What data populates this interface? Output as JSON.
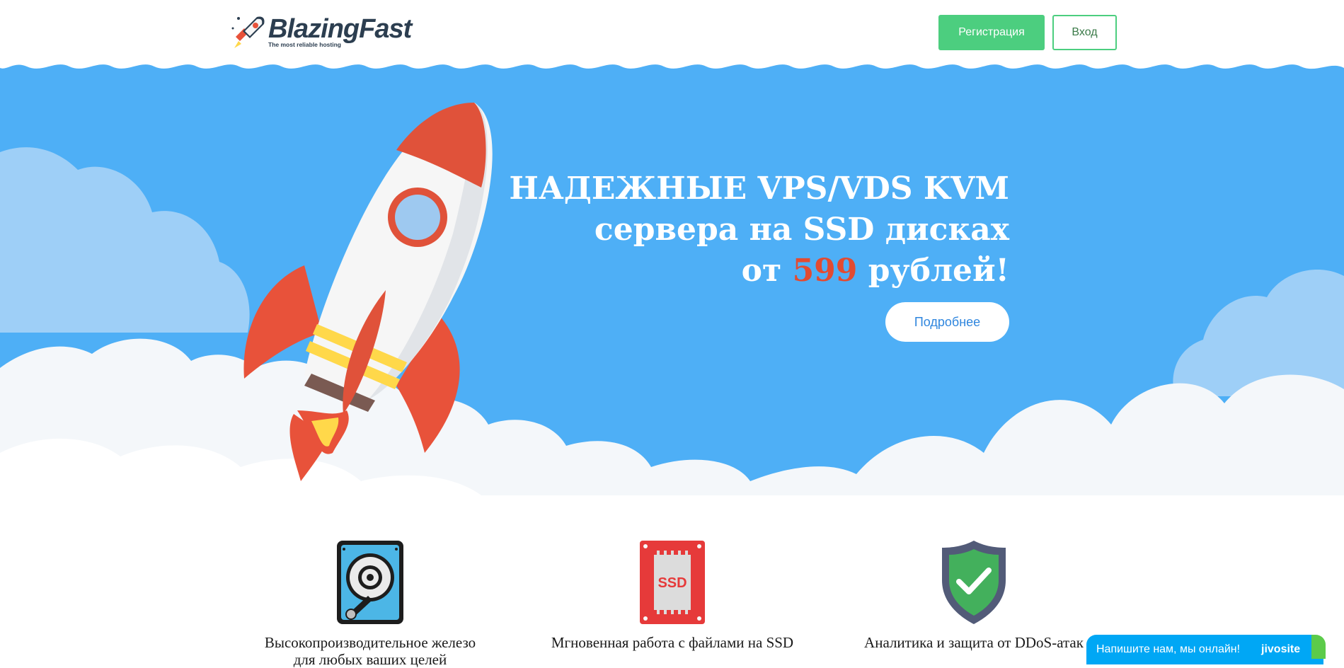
{
  "header": {
    "logo_name": "BlazingFast",
    "logo_tagline": "The most reliable hosting",
    "register_label": "Регистрация",
    "login_label": "Вход"
  },
  "hero": {
    "line1": "НАДЕЖНЫЕ VPS/VDS KVM",
    "line2": "сервера на SSD дисках",
    "line3_prefix": "от ",
    "price": "599",
    "line3_suffix": " рублей!",
    "more_label": "Подробнее"
  },
  "features": [
    {
      "icon": "hard-drive-icon",
      "label_line1": "Высокопроизводительное железо",
      "label_line2": "для любых ваших целей"
    },
    {
      "icon": "ssd-chip-icon",
      "ssd_text": "SSD",
      "label_line1": "Мгновенная работа с файлами на SSD"
    },
    {
      "icon": "shield-check-icon",
      "label_line1": "Аналитика и защита от DDoS-атак"
    }
  ],
  "chat": {
    "text": "Напишите нам, мы онлайн!",
    "brand": "jivosite"
  },
  "colors": {
    "sky": "#4eaff6",
    "accent_green": "#4cce7f",
    "price_red": "#e24b32",
    "link_blue": "#2f86de",
    "chat_blue": "#00a7f5"
  }
}
